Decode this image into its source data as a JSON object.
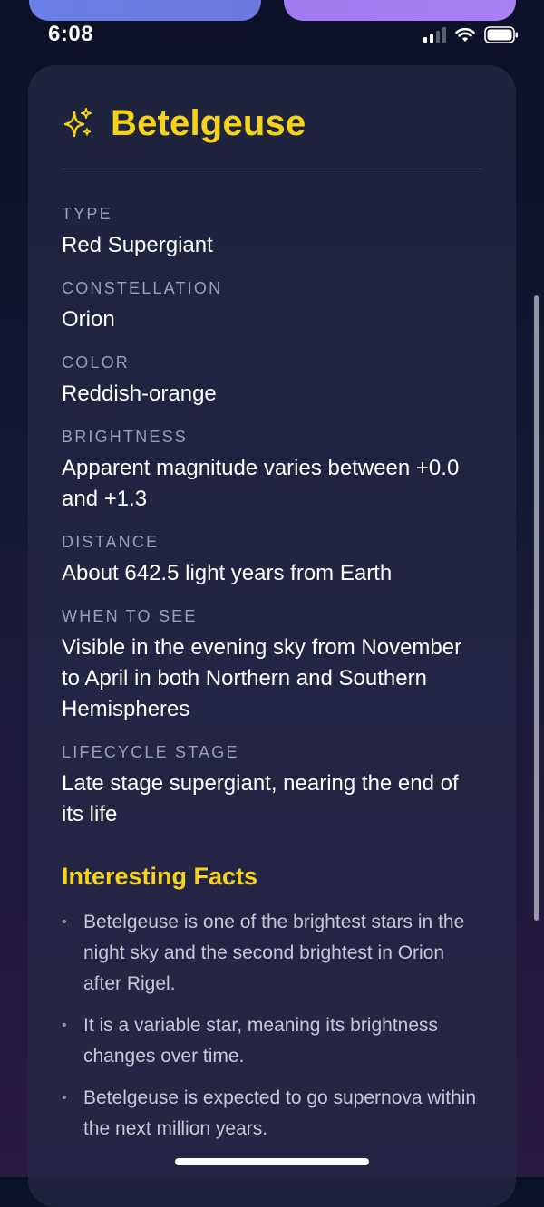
{
  "status_bar": {
    "time": "6:08"
  },
  "star": {
    "name": "Betelgeuse",
    "icon": "sparkles-icon",
    "fields": [
      {
        "label": "TYPE",
        "value": "Red Supergiant"
      },
      {
        "label": "CONSTELLATION",
        "value": "Orion"
      },
      {
        "label": "COLOR",
        "value": "Reddish-orange"
      },
      {
        "label": "BRIGHTNESS",
        "value": "Apparent magnitude varies between +0.0 and +1.3"
      },
      {
        "label": "DISTANCE",
        "value": "About 642.5 light years from Earth"
      },
      {
        "label": "WHEN TO SEE",
        "value": "Visible in the evening sky from November to April in both Northern and Southern Hemispheres"
      },
      {
        "label": "LIFECYCLE STAGE",
        "value": "Late stage supergiant, nearing the end of its life"
      }
    ]
  },
  "facts": {
    "heading": "Interesting Facts",
    "items": [
      "Betelgeuse is one of the brightest stars in the night sky and the second brightest in Orion after Rigel.",
      "It is a variable star, meaning its brightness changes over time.",
      "Betelgeuse is expected to go supernova within the next million years."
    ]
  },
  "colors": {
    "accent": "#f7d21b",
    "label": "#98a0bd",
    "pill_left": "#6a7ee6",
    "pill_right": "#a97ff4"
  }
}
